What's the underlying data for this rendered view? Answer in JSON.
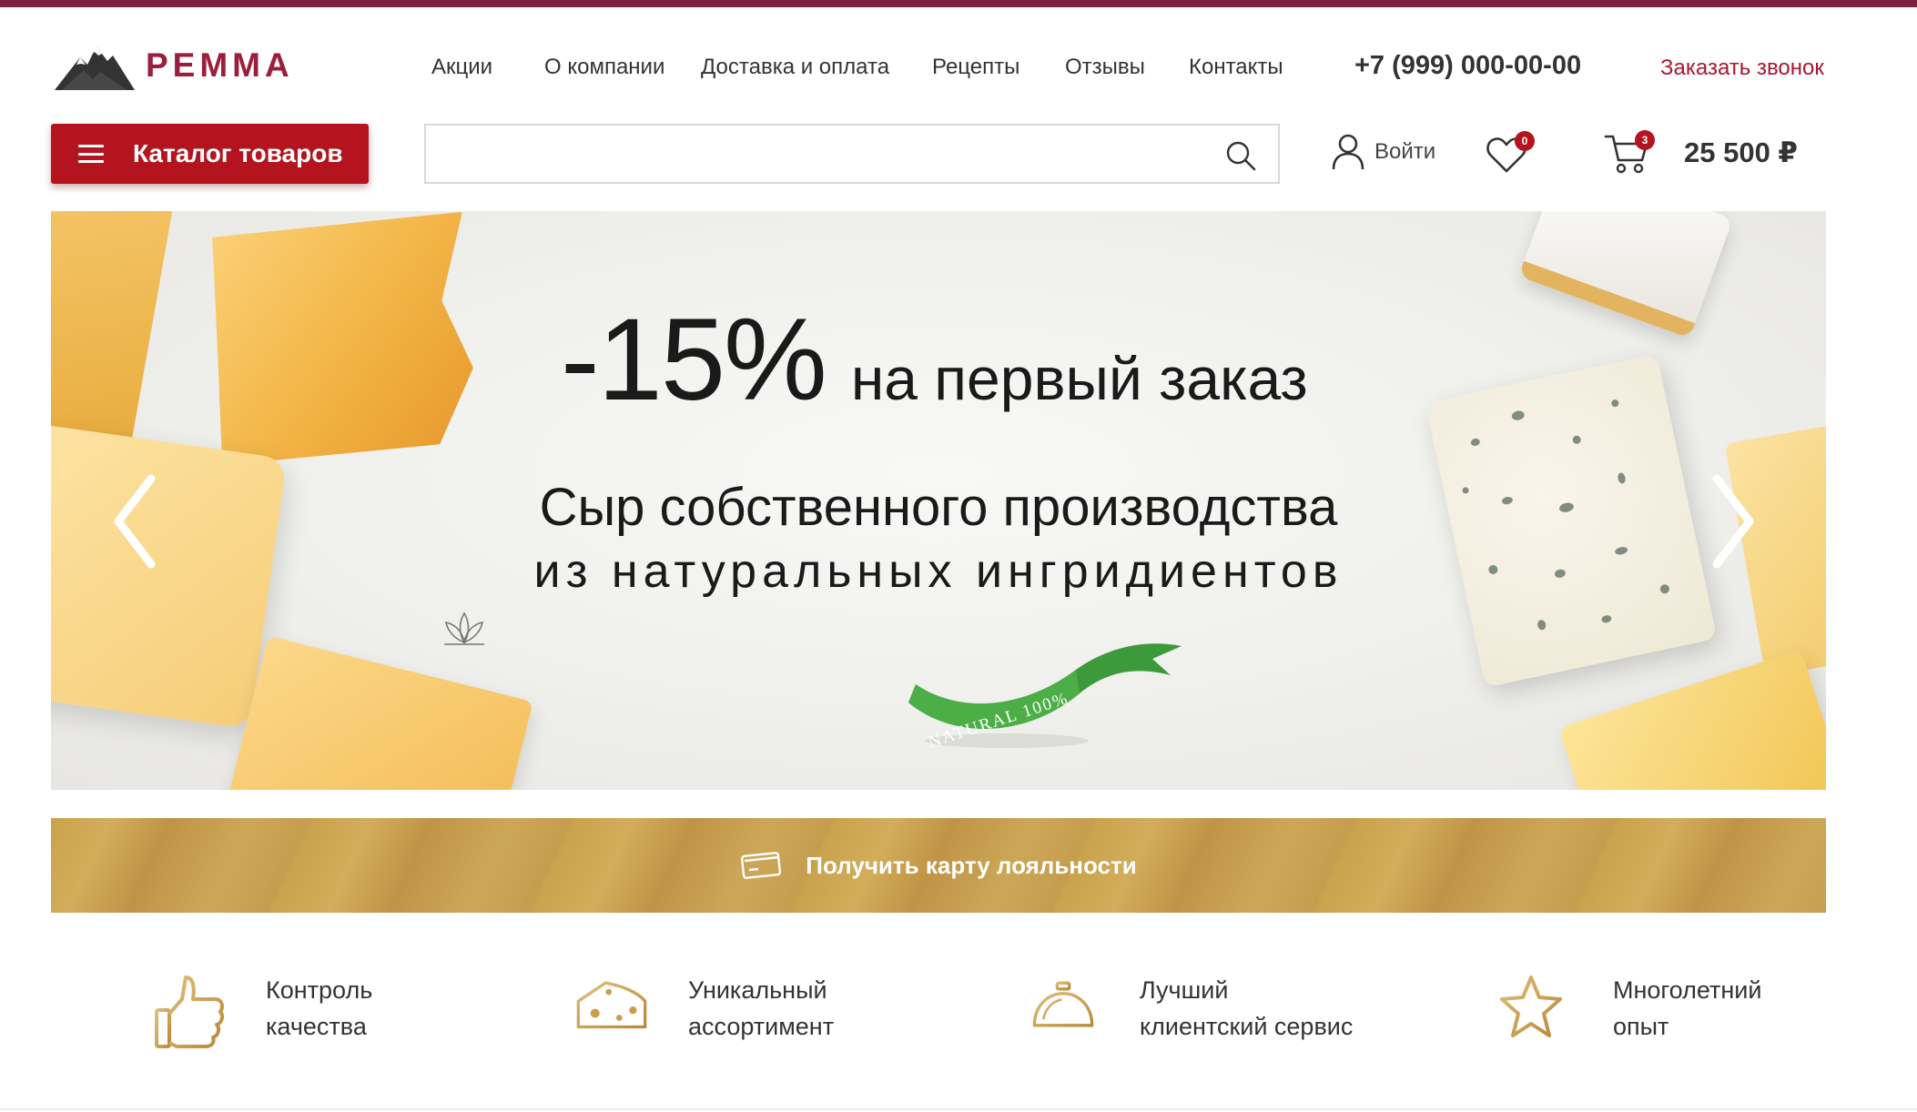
{
  "brand": {
    "name": "РЕММА",
    "accent": "#b3141e",
    "gold": "#c9a24d"
  },
  "nav": {
    "items": [
      {
        "label": "Акции"
      },
      {
        "label": "О компании"
      },
      {
        "label": "Доставка и оплата"
      },
      {
        "label": "Рецепты"
      },
      {
        "label": "Отзывы"
      },
      {
        "label": "Контакты"
      }
    ]
  },
  "header": {
    "phone": "+7 (999) 000-00-00",
    "callback": "Заказать звонок",
    "catalog": "Каталог товаров",
    "search": {
      "value": "",
      "placeholder": ""
    },
    "login": "Войти",
    "favorites_count": "0",
    "cart_count": "3",
    "cart_total": "25 500 ₽"
  },
  "banner": {
    "discount": "-15%",
    "discount_text": "на первый заказ",
    "headline_line1": "Сыр собственного производства",
    "headline_line2": "из натуральных ингридиентов",
    "ribbon": "NATURAL 100%"
  },
  "loyalty": {
    "label": "Получить карту лояльности"
  },
  "features": [
    {
      "icon": "thumbs-up-icon",
      "line1": "Контроль",
      "line2": "качества"
    },
    {
      "icon": "cheese-icon",
      "line1": "Уникальный",
      "line2": "ассортимент"
    },
    {
      "icon": "service-bell-icon",
      "line1": "Лучший",
      "line2": "клиентский сервис"
    },
    {
      "icon": "star-icon",
      "line1": "Многолетний",
      "line2": "опыт"
    }
  ]
}
